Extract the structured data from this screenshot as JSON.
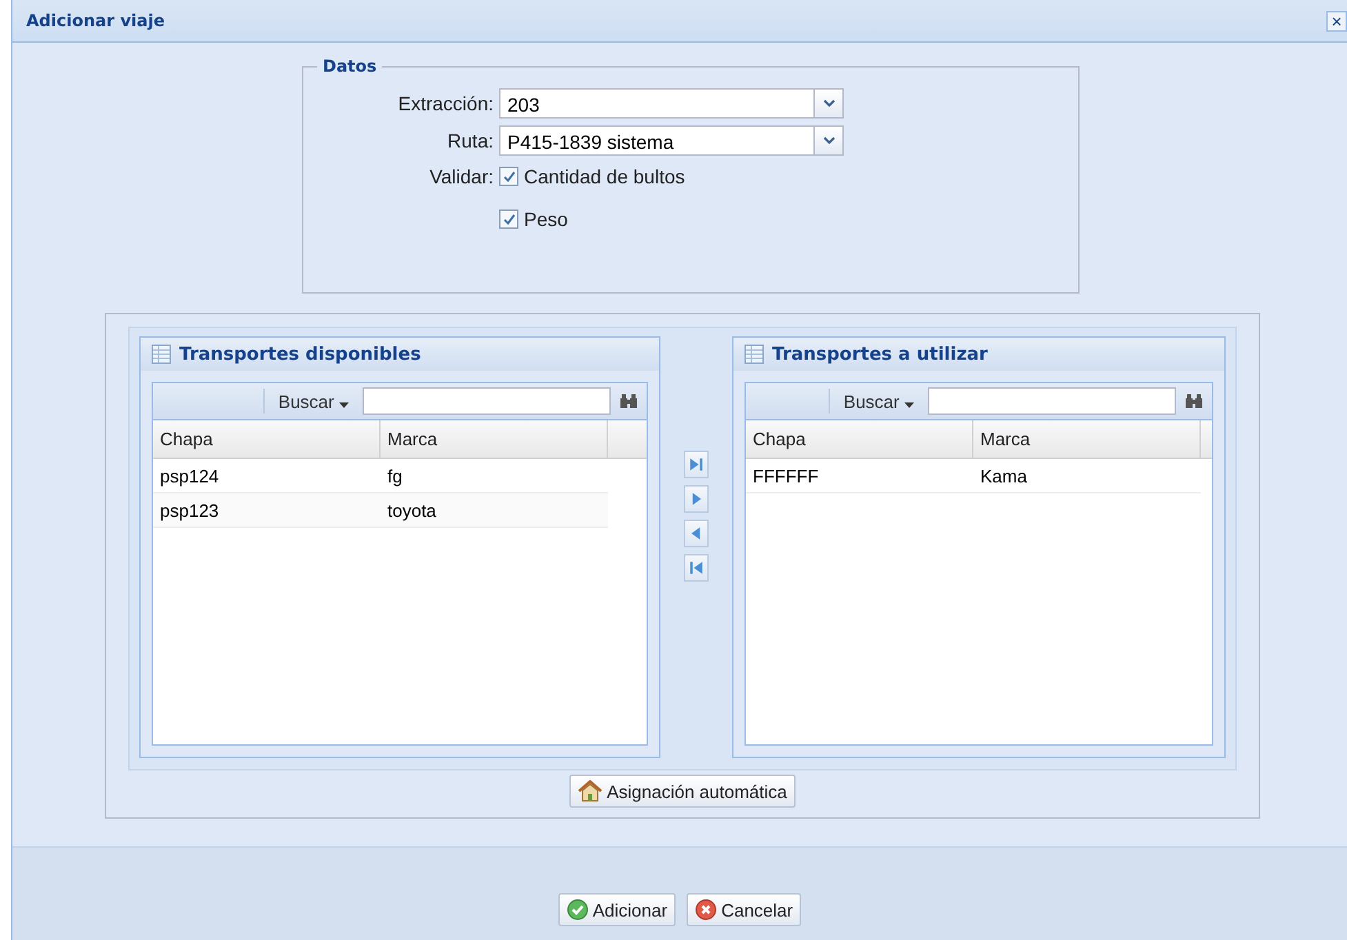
{
  "window": {
    "title": "Adicionar viaje",
    "close": "×"
  },
  "datos": {
    "legend": "Datos",
    "fields": [
      {
        "label": "Extracción:",
        "value": "203"
      },
      {
        "label": "Ruta:",
        "value": "P415-1839 sistema"
      }
    ],
    "validar_label": "Validar:",
    "checks": [
      {
        "label": "Cantidad de bultos",
        "checked": true
      },
      {
        "label": "Peso",
        "checked": true
      }
    ]
  },
  "panels": [
    {
      "title": "Transportes disponibles",
      "search_label": "Buscar",
      "columns": [
        "Chapa",
        "Marca"
      ],
      "rows": [
        [
          "psp124",
          "fg"
        ],
        [
          "psp123",
          "toyota"
        ]
      ]
    },
    {
      "title": "Transportes a utilizar",
      "search_label": "Buscar",
      "columns": [
        "Chapa",
        "Marca"
      ],
      "rows": [
        [
          "FFFFFF",
          "Kama"
        ]
      ]
    }
  ],
  "transfer_buttons": [
    {
      "kind": "all-right"
    },
    {
      "kind": "right"
    },
    {
      "kind": "left"
    },
    {
      "kind": "all-left"
    }
  ],
  "auto_button": "Asignación automática",
  "buttons": [
    {
      "kind": "ok",
      "label": "Adicionar"
    },
    {
      "kind": "cancel",
      "label": "Cancelar"
    }
  ]
}
